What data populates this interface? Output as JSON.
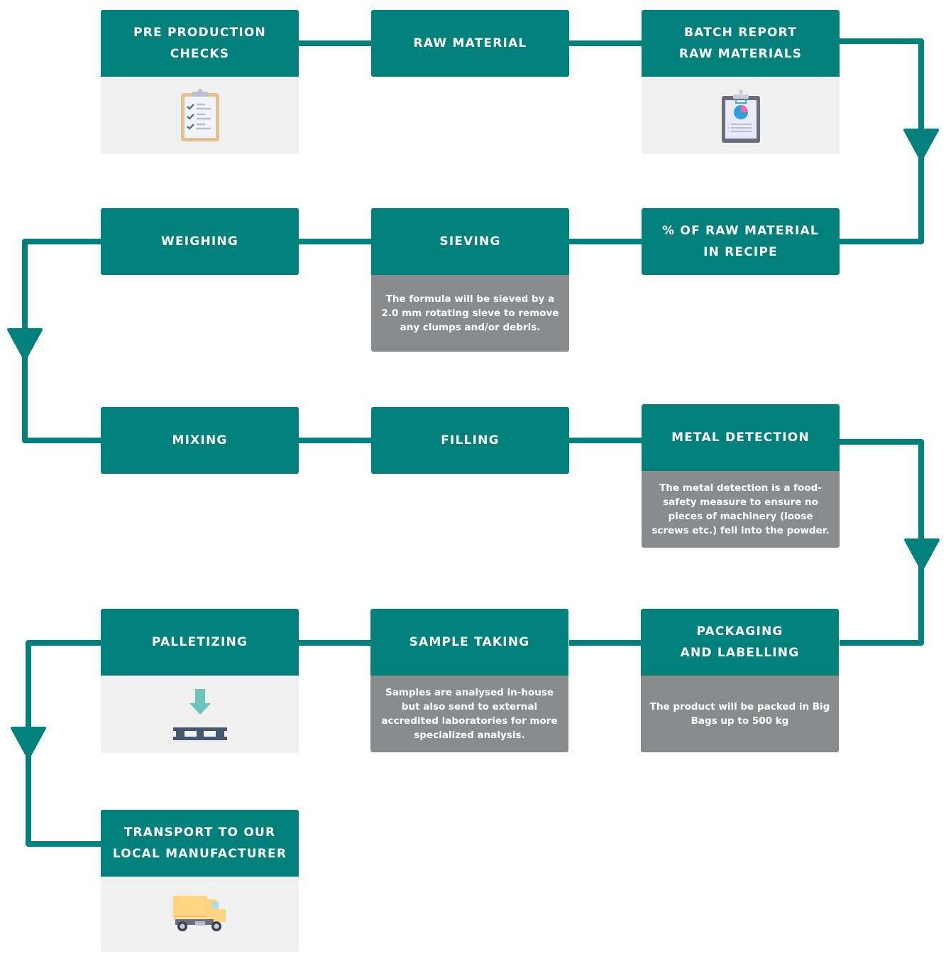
{
  "colors": {
    "primary": "#00807a",
    "header_text": "#ffffff",
    "icon_panel": "#f0f0f0",
    "description_panel": "#8a8b8d"
  },
  "steps": [
    {
      "id": "pre-production-checks",
      "title": "PRE PRODUCTION\nCHECKS",
      "icon": "clipboard-checklist-icon"
    },
    {
      "id": "raw-material",
      "title": "RAW MATERIAL"
    },
    {
      "id": "batch-report",
      "title": "BATCH REPORT\nRAW MATERIALS",
      "icon": "clipboard-pie-chart-icon"
    },
    {
      "id": "percent-raw-material",
      "title": "% OF RAW MATERIAL\nIN RECIPE"
    },
    {
      "id": "sieving",
      "title": "SIEVING",
      "description": "The formula will be sieved by a 2.0 mm rotating sieve to remove any clumps and/or debris."
    },
    {
      "id": "weighing",
      "title": "WEIGHING"
    },
    {
      "id": "mixing",
      "title": "MIXING"
    },
    {
      "id": "filling",
      "title": "FILLING"
    },
    {
      "id": "metal-detection",
      "title": "METAL DETECTION",
      "description": "The metal detection is a food-safety measure to ensure no pieces of machinery (loose screws etc.) fell into the powder."
    },
    {
      "id": "packaging-labelling",
      "title": "PACKAGING\nAND LABELLING",
      "description": "The product will be packed in Big Bags up to 500 kg"
    },
    {
      "id": "sample-taking",
      "title": "SAMPLE TAKING",
      "description": "Samples are analysed in-house but also send to external accredited laboratories for more specialized analysis."
    },
    {
      "id": "palletizing",
      "title": "PALLETIZING",
      "icon": "pallet-arrow-icon"
    },
    {
      "id": "transport",
      "title": "TRANSPORT TO OUR\nLOCAL MANUFACTURER",
      "icon": "delivery-truck-icon"
    }
  ]
}
